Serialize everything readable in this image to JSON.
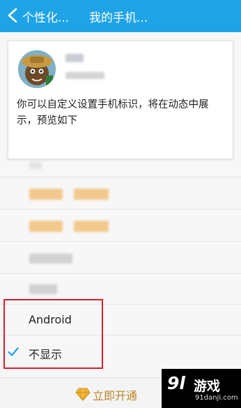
{
  "header": {
    "back_label": "个性化...",
    "title": "我的手机..."
  },
  "preview_card": {
    "description": "你可以自定义设置手机标识，将在动态中展示，预览如下"
  },
  "options": [
    {
      "label": "Android",
      "selected": false
    },
    {
      "label": "不显示",
      "selected": true
    }
  ],
  "footer": {
    "open_vip_label": "立即开通"
  },
  "watermark": {
    "logo": "9l",
    "game_text": "游戏",
    "site": "91danji.com"
  },
  "colors": {
    "header_bg": "#1ea4e6",
    "check_color": "#1ea4e6",
    "highlight_border": "#d81e28",
    "vip_text": "#b8862b"
  }
}
